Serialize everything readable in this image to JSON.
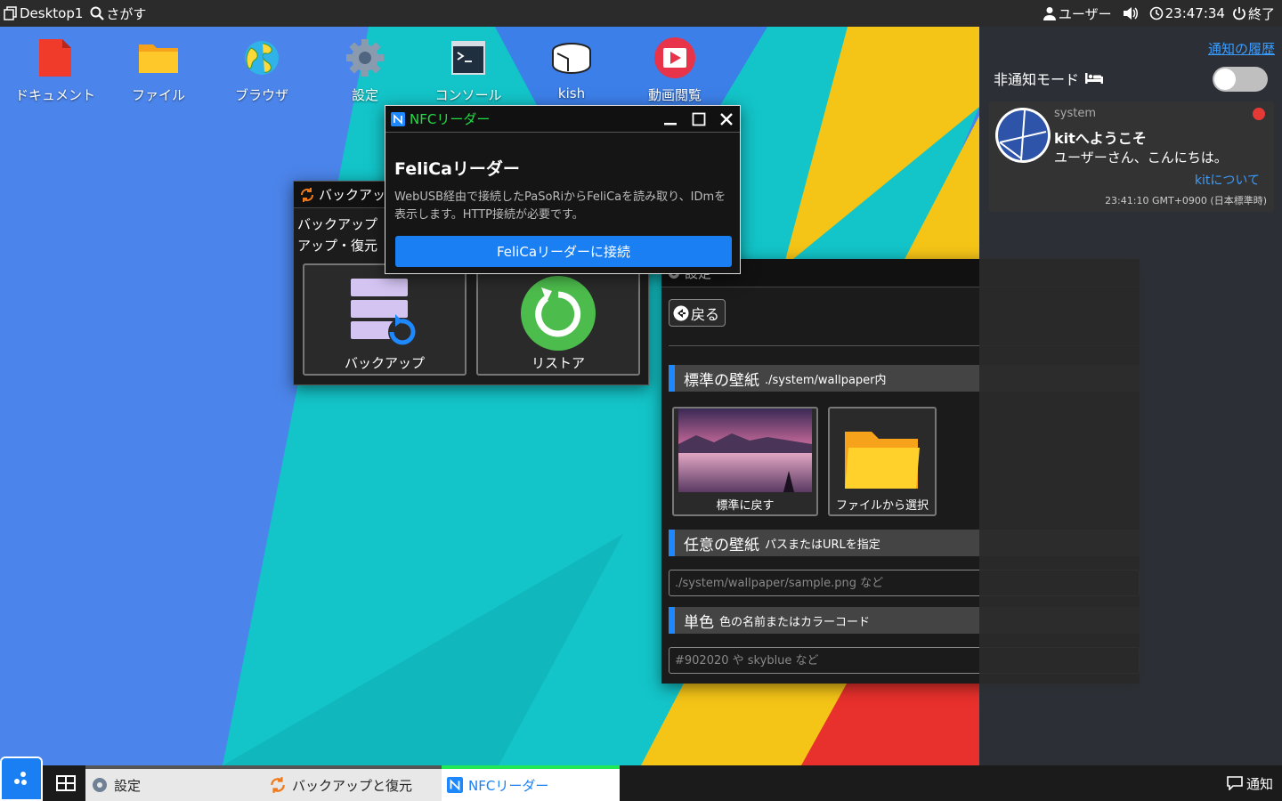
{
  "topbar": {
    "desktop_label": "Desktop1",
    "search_label": "さがす",
    "user_label": "ユーザー",
    "clock": "23:47:34",
    "power_label": "終了"
  },
  "desktop_icons": [
    {
      "label": "ドキュメント",
      "icon": "document-icon"
    },
    {
      "label": "ファイル",
      "icon": "folder-icon"
    },
    {
      "label": "ブラウザ",
      "icon": "globe-icon"
    },
    {
      "label": "設定",
      "icon": "gear-icon"
    },
    {
      "label": "コンソール",
      "icon": "terminal-icon"
    },
    {
      "label": "kish",
      "icon": "kish-icon"
    },
    {
      "label": "動画閲覧",
      "icon": "video-play-icon"
    }
  ],
  "backup_window": {
    "title": "バックアップと復元",
    "desc_line1": "バックアップ",
    "desc_line2": "アップ・復元",
    "backup_label": "バックアップ",
    "restore_label": "リストア"
  },
  "nfc_window": {
    "title": "NFCリーダー",
    "heading": "FeliCaリーダー",
    "description": "WebUSB経由で接続したPaSoRiからFeliCaを読み取り、IDmを表示します。HTTP接続が必要です。",
    "connect_label": "FeliCaリーダーに接続"
  },
  "settings_window": {
    "title": "設定",
    "back_label": "戻る",
    "section_standard": {
      "title": "標準の壁紙",
      "sub": "./system/wallpaper内"
    },
    "restore_default_label": "標準に戻す",
    "choose_file_label": "ファイルから選択",
    "section_custom": {
      "title": "任意の壁紙",
      "sub": "パスまたはURLを指定"
    },
    "custom_placeholder": "./system/wallpaper/sample.png など",
    "section_color": {
      "title": "単色",
      "sub": "色の名前またはカラーコード"
    },
    "color_placeholder": "#902020 や skyblue など"
  },
  "notification_panel": {
    "history_link": "通知の履歴",
    "dnd_label": "非通知モード",
    "card": {
      "source": "system",
      "title": "kitへようこそ",
      "body": "ユーザーさん、こんにちは。",
      "link": "kitについて",
      "timestamp": "23:41:10 GMT+0900 (日本標準時)"
    }
  },
  "taskbar": {
    "tasks": [
      {
        "label": "設定",
        "icon": "gear-icon"
      },
      {
        "label": "バックアップと復元",
        "icon": "sync-icon"
      },
      {
        "label": "NFCリーダー",
        "icon": "nfc-icon"
      }
    ],
    "notify_label": "通知"
  },
  "colors": {
    "accent": "#1a7ff2",
    "nfc_title": "#22dd44",
    "notify_dot": "#e53935"
  }
}
